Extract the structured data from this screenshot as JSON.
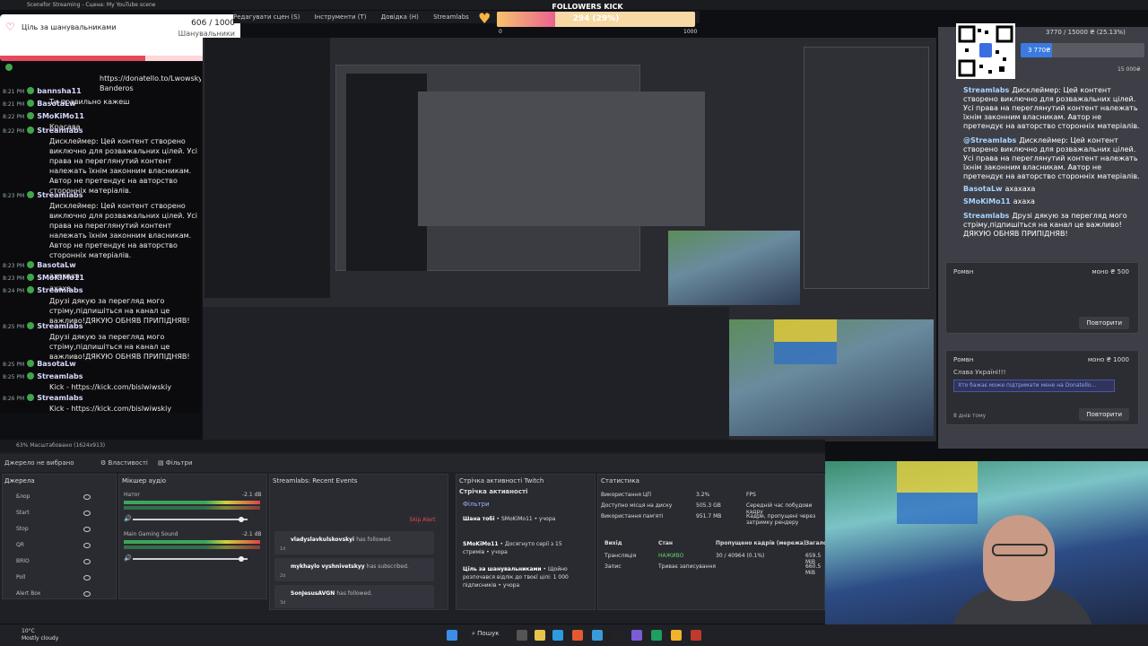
{
  "window": {
    "title": "Scenefor Streaming - Сцена: My YouTube scene",
    "menu": [
      "Редагувати сцен (S)",
      "Інструменти (T)",
      "Довідка (H)",
      "Streamlabs"
    ]
  },
  "goal_widget": {
    "label": "Ціль за шанувальниками",
    "count": "606 / 1000",
    "unit": "Шанувальники",
    "progress": 0.606
  },
  "followers_kick": {
    "title": "FOLLOWERS KICK",
    "value_text": "294 (29%)",
    "progress": 0.294,
    "min": "0",
    "max": "1000"
  },
  "chat_left": [
    {
      "time": "",
      "nick": "",
      "text": "https://donatello.to/Lwowsky Banderos"
    },
    {
      "time": "8:21 PM",
      "nick": "bannsha11",
      "text": "Ти правильно кажеш"
    },
    {
      "time": "8:21 PM",
      "nick": "BasotaLw",
      "text": ""
    },
    {
      "time": "8:22 PM",
      "nick": "SMoKiMo11",
      "text": "Красава"
    },
    {
      "time": "8:22 PM",
      "nick": "Streamlabs",
      "text": "Дисклеймер: Цей контент створено виключно для розважальних цілей. Усі права на переглянутий контент належать їхнім законним власникам. Автор не претендує на авторство сторонніх матеріалів."
    },
    {
      "time": "8:23 PM",
      "nick": "Streamlabs",
      "text": "Дисклеймер: Цей контент створено виключно для розважальних цілей. Усі права на переглянутий контент належать їхнім законним власникам. Автор не претендує на авторство сторонніх матеріалів."
    },
    {
      "time": "8:23 PM",
      "nick": "BasotaLw",
      "text": "ахахаха"
    },
    {
      "time": "8:23 PM",
      "nick": "SMoKiMo11",
      "text": "ахаха"
    },
    {
      "time": "8:24 PM",
      "nick": "Streamlabs",
      "text": "Друзі дякую за перегляд мого стріму,підпишіться на канал це важливо!ДЯКУЮ ОБНЯВ ПРИПІДНЯВ!"
    },
    {
      "time": "8:25 PM",
      "nick": "Streamlabs",
      "text": "Друзі дякую за перегляд мого стріму,підпишіться на канал це важливо!ДЯКУЮ ОБНЯВ ПРИПІДНЯВ!"
    },
    {
      "time": "8:25 PM",
      "nick": "BasotaLw",
      "text": ""
    },
    {
      "time": "8:25 PM",
      "nick": "Streamlabs",
      "text": "Kick - https://kick.com/bislwiwskiy"
    },
    {
      "time": "8:26 PM",
      "nick": "Streamlabs",
      "text": "Kick - https://kick.com/bislwiwskiy"
    }
  ],
  "right_overlay": {
    "donation_text": "3770 / 15000 ₴ (25.13%)",
    "donation_value": "3 770₴",
    "donation_max": "15 000₴",
    "donation_progress": 0.2513,
    "messages": [
      {
        "nick": "Streamlabs",
        "text": "Дисклеймер: Цей контент створено виключно для розважальних цілей. Усі права на переглянутий контент належать їхнім законним власникам. Автор не претендує на авторство сторонніх матеріалів."
      },
      {
        "nick": "@Streamlabs",
        "text": "Дисклеймер: Цей контент створено виключно для розважальних цілей. Усі права на переглянутий контент належать їхнім законним власникам. Автор не претендує на авторство сторонніх матеріалів."
      },
      {
        "nick": "BasotaLw",
        "text": "ахахаха"
      },
      {
        "nick": "SMoKiMo11",
        "text": "ахаха"
      },
      {
        "nick": "Streamlabs",
        "text": "Друзі дякую за перегляд мого стріму,підпишіться на канал це важливо! ДЯКУЮ ОБНЯВ ПРИПІДНЯВ!"
      },
      {
        "nick": "Streamlabs",
        "text": "Kick - https://kick.com/bislwiwskiy"
      },
      {
        "nick": "Streamlabs",
        "text": "Kick - https://kick.com/bislwiwskiy"
      }
    ],
    "cards": [
      {
        "who": "Ромвн",
        "amount": "моно ₴ 500",
        "text": "",
        "ago": "",
        "button": "Повторити"
      },
      {
        "who": "Ромвн",
        "amount": "моно ₴ 1000",
        "text": "Слава Україні!!!",
        "placeholder": "Хто бажає може підтримати мене на Donatello...",
        "ago": "8 днів тому",
        "button": "Повторити"
      }
    ]
  },
  "obs": {
    "status_bar": "63%   Масштабовано (1624x913)",
    "no_source": "Джерело не вибрано",
    "props_btn": "Властивості",
    "filters_btn": "Фільтри",
    "sources": {
      "title": "Джерела",
      "items": [
        "Блор",
        "Start",
        "Stop",
        "QR",
        "BRIO",
        "Poll",
        "Alert Box"
      ]
    },
    "mixer": {
      "title": "Мікшер аудіо",
      "channels": [
        {
          "name": "Натоr",
          "db": "-2.1 dB"
        },
        {
          "name": "Main Gaming Sound",
          "db": "-2.1 dB"
        }
      ]
    },
    "recent_events": {
      "title": "Streamlabs: Recent Events",
      "skip": "Skip Alert",
      "events": [
        {
          "who": "vladyslavkulskovskyi",
          "action": "has followed.",
          "ago": "1d"
        },
        {
          "who": "mykhaylo vyshnivetskyy",
          "action": "has subscribed.",
          "ago": "2d"
        },
        {
          "who": "SonJesusAVGN",
          "action": "has followed.",
          "ago": "3d"
        }
      ]
    },
    "twitch_activity": {
      "title": "Стрічка активності Twitch",
      "subtitle": "Стрічка активності",
      "filters": "Фільтри",
      "items": [
        {
          "bold": "Шана тобі",
          "text": "• SMoKiMo11 • учора"
        },
        {
          "bold": "SMoKiMo11",
          "text": "• Досягнуто серії з 15 стримів • учора"
        },
        {
          "bold": "Ціль за шанувальниками",
          "text": "• Щойно розпочався відлік до твоєї цілі: 1 000 підписників • учора"
        }
      ]
    },
    "stats": {
      "title": "Статистика",
      "rows": [
        {
          "k": "Використання ЦП",
          "v": "3.2%",
          "r": "FPS"
        },
        {
          "k": "Доступно місця на диску",
          "v": "505.3 GB",
          "r": "Середній час побудови кадру"
        },
        {
          "k": "Використання пам'яті",
          "v": "951.7 MB",
          "r": "Кадри, пропущені через затримку рендеру"
        }
      ],
      "table_head": [
        "Вихід",
        "Стан",
        "Пропущено кадрів (мережа)",
        "Загалом"
      ],
      "table_rows": [
        [
          "Трансляція",
          "НАЖИВО",
          "30 / 40964 (0.1%)",
          "659.5 MiB"
        ],
        [
          "Запис",
          "Триває записування",
          "",
          "660.5 MiB"
        ]
      ]
    }
  },
  "taskbar": {
    "weather_temp": "10°C",
    "weather_desc": "Mostly cloudy",
    "search": "Пошук"
  },
  "colors": {
    "accent_red": "#e34a5e",
    "accent_blue": "#3b7ae0",
    "live_green": "#3fa64a"
  }
}
